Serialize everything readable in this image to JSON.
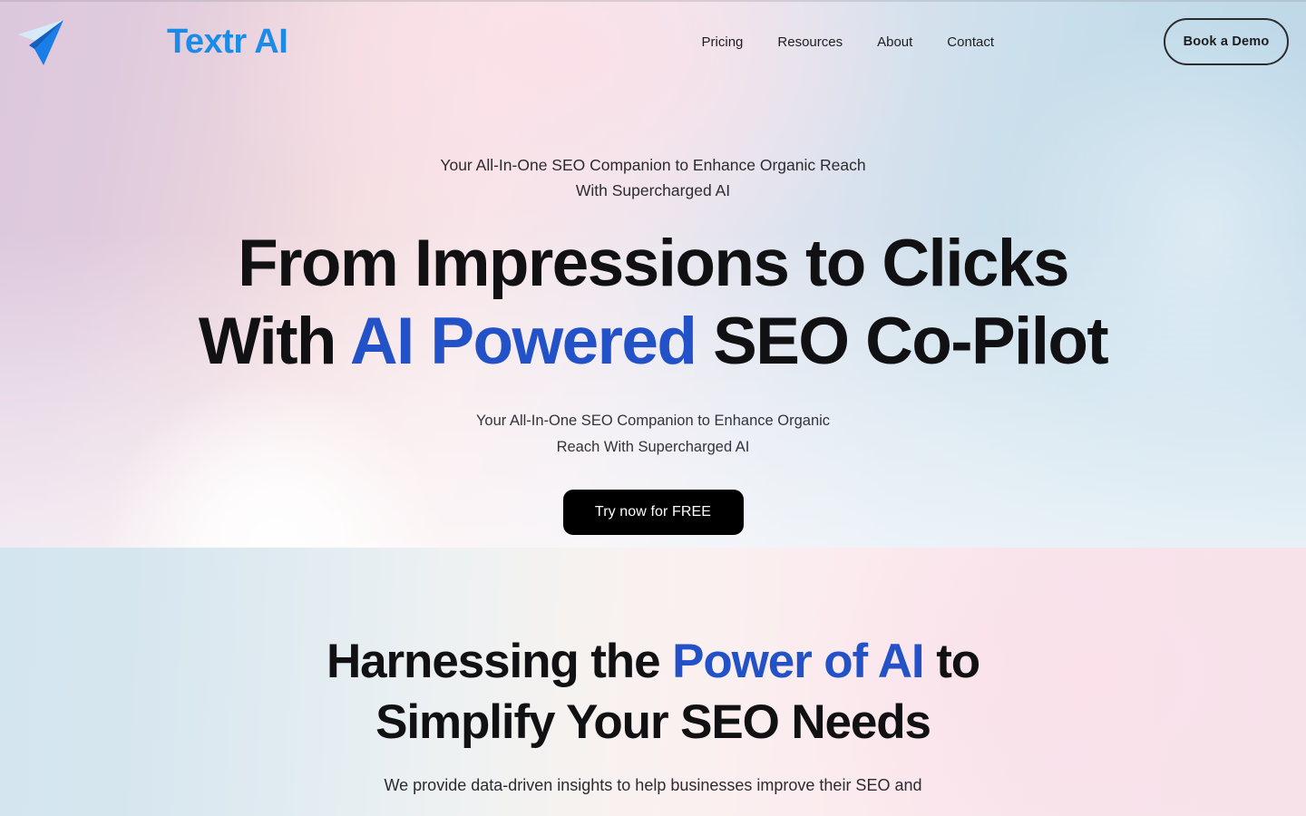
{
  "brand": {
    "name": "Textr AI",
    "logo_icon": "paper-plane-icon",
    "color": "#1a8ce8"
  },
  "nav": {
    "links": [
      {
        "label": "Pricing"
      },
      {
        "label": "Resources"
      },
      {
        "label": "About"
      },
      {
        "label": "Contact"
      }
    ],
    "cta": {
      "label": "Book a Demo"
    }
  },
  "hero": {
    "eyebrow_line1": "Your All-In-One SEO Companion to Enhance Organic Reach",
    "eyebrow_line2": "With Supercharged AI",
    "headline_line1": "From Impressions to Clicks",
    "headline_line2_pre": "With ",
    "headline_line2_accent": "AI Powered",
    "headline_line2_post": " SEO Co-Pilot",
    "subcopy_line1": "Your All-In-One SEO Companion to Enhance Organic",
    "subcopy_line2": "Reach With Supercharged AI",
    "cta": {
      "label": "Try now for FREE"
    },
    "accent_color": "#2352c8"
  },
  "features": {
    "title_pre": "Harnessing the ",
    "title_accent": "Power of AI",
    "title_post": " to",
    "title_line2": "Simplify Your SEO Needs",
    "subtitle": "We provide data-driven insights to help businesses improve their SEO and"
  }
}
